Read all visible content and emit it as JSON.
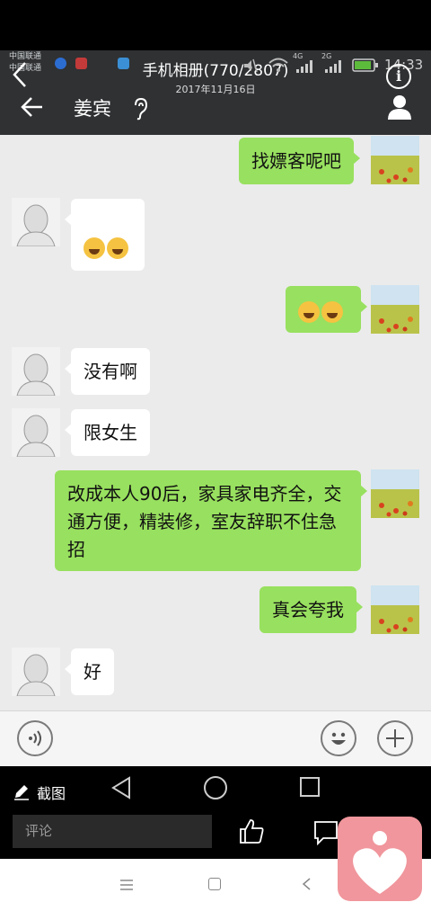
{
  "status_bar": {
    "carrier_1": "中国联通",
    "carrier_2": "中国联通",
    "network_1": "4G",
    "network_2": "2G",
    "time": "14:33"
  },
  "gallery": {
    "title": "手机相册(770/2807)",
    "date": "2017年11月16日"
  },
  "chat": {
    "contact_name": "姜宾",
    "messages": [
      {
        "dir": "out",
        "text": "找嫖客呢吧"
      },
      {
        "dir": "in",
        "text": ""
      },
      {
        "dir": "out",
        "text": ""
      },
      {
        "dir": "in",
        "text": "没有啊"
      },
      {
        "dir": "in",
        "text": "限女生"
      },
      {
        "dir": "out",
        "text": "改成本人90后，家具家电齐全，交通方便，精装修，室友辞职不住急招"
      },
      {
        "dir": "out",
        "text": "真会夸我"
      },
      {
        "dir": "in",
        "text": "好"
      }
    ]
  },
  "bottom": {
    "screenshot_label": "截图",
    "comment_placeholder": "评论"
  },
  "colors": {
    "outgoing_bubble": "#98e05f",
    "incoming_bubble": "#ffffff",
    "chat_background": "#ebebeb",
    "title_bar": "#2f3133",
    "favorite_badge": "#f0969c"
  }
}
